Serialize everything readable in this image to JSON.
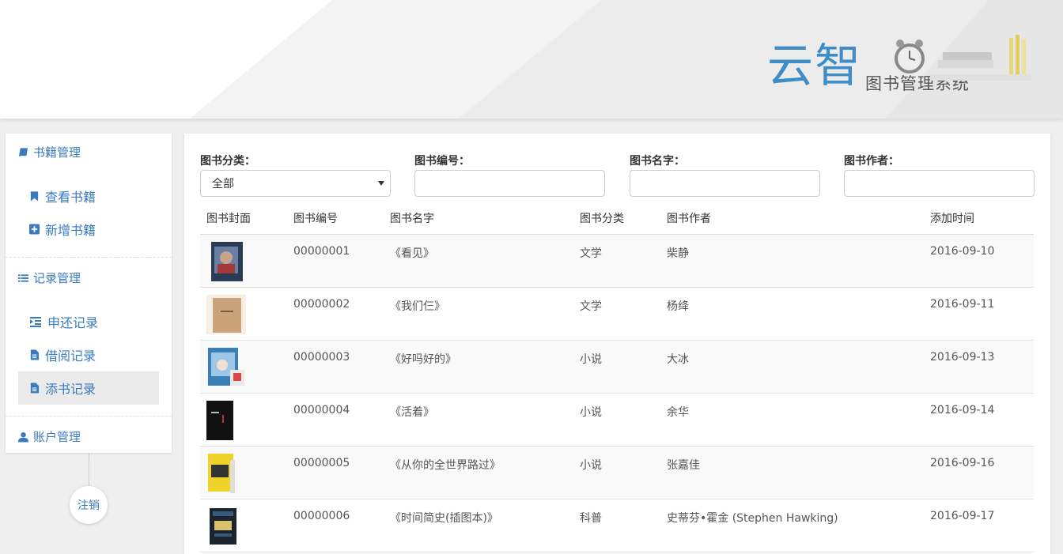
{
  "header": {
    "logo_main": "云智",
    "logo_sub": "图书管理系统"
  },
  "sidebar": {
    "book_mgmt": "书籍管理",
    "view_books": "查看书籍",
    "add_book": "新增书籍",
    "record_mgmt": "记录管理",
    "return_records": "申还记录",
    "borrow_records": "借阅记录",
    "add_records": "添书记录",
    "account_mgmt": "账户管理",
    "logout": "注销"
  },
  "filters": {
    "category_label": "图书分类：",
    "category_value": "全部",
    "number_label": "图书编号：",
    "number_value": "",
    "name_label": "图书名字：",
    "name_value": "",
    "author_label": "图书作者：",
    "author_value": ""
  },
  "table": {
    "headers": [
      "图书封面",
      "图书编号",
      "图书名字",
      "图书分类",
      "图书作者",
      "添加时间"
    ],
    "rows": [
      {
        "id": "00000001",
        "name": "《看见》",
        "category": "文学",
        "author": "柴静",
        "date": "2016-09-10"
      },
      {
        "id": "00000002",
        "name": "《我们仨》",
        "category": "文学",
        "author": "杨绛",
        "date": "2016-09-11"
      },
      {
        "id": "00000003",
        "name": "《好吗好的》",
        "category": "小说",
        "author": "大冰",
        "date": "2016-09-13"
      },
      {
        "id": "00000004",
        "name": "《活着》",
        "category": "小说",
        "author": "余华",
        "date": "2016-09-14"
      },
      {
        "id": "00000005",
        "name": "《从你的全世界路过》",
        "category": "小说",
        "author": "张嘉佳",
        "date": "2016-09-16"
      },
      {
        "id": "00000006",
        "name": "《时间简史(插图本)》",
        "category": "科普",
        "author": "史蒂芬•霍金 (Stephen Hawking)",
        "date": "2016-09-17"
      }
    ]
  },
  "colors": {
    "accent": "#3a7bbf",
    "logo_blue": "#3e8cc8"
  }
}
